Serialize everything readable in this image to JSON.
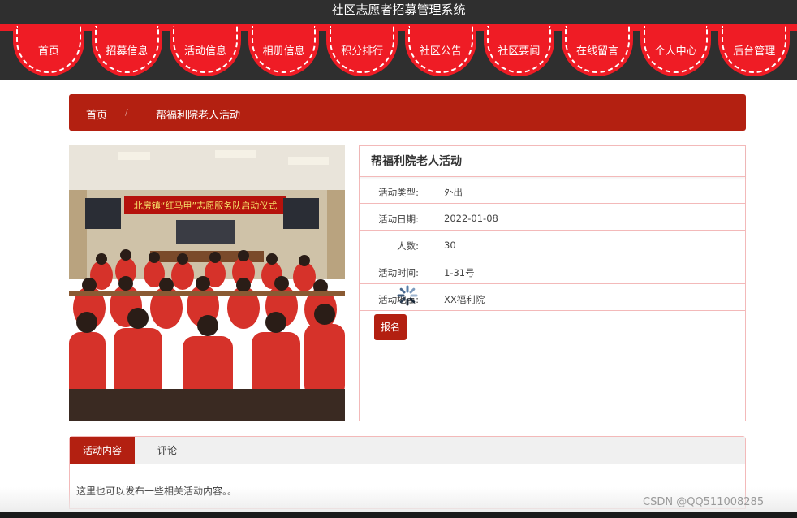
{
  "app": {
    "title": "社区志愿者招募管理系统"
  },
  "nav": {
    "items": [
      {
        "label": "首页"
      },
      {
        "label": "招募信息"
      },
      {
        "label": "活动信息"
      },
      {
        "label": "相册信息"
      },
      {
        "label": "积分排行"
      },
      {
        "label": "社区公告"
      },
      {
        "label": "社区要闻"
      },
      {
        "label": "在线留言"
      },
      {
        "label": "个人中心"
      },
      {
        "label": "后台管理"
      }
    ]
  },
  "breadcrumb": {
    "home": "首页",
    "separator": "/",
    "current": "帮福利院老人活动"
  },
  "photo": {
    "banner_text": "北房镇“红马甲”志愿服务队启动仪式"
  },
  "detail": {
    "title": "帮福利院老人活动",
    "fields": [
      {
        "label": "活动类型:",
        "value": "外出"
      },
      {
        "label": "活动日期:",
        "value": "2022-01-08"
      },
      {
        "label": "人数:",
        "value": "30"
      },
      {
        "label": "活动时间:",
        "value": "1-31号"
      },
      {
        "label": "活动地点:",
        "value": "XX福利院"
      }
    ],
    "signup_label": "报名"
  },
  "tabs": {
    "items": [
      {
        "label": "活动内容"
      },
      {
        "label": "评论"
      }
    ],
    "content": "这里也可以发布一些相关活动内容。。"
  },
  "watermark": "CSDN @QQ511008285",
  "colors": {
    "brand_red": "#ef1c25",
    "dark_red": "#b32011",
    "header_dark": "#2f2f2f",
    "panel_border": "#f3b9b9"
  }
}
